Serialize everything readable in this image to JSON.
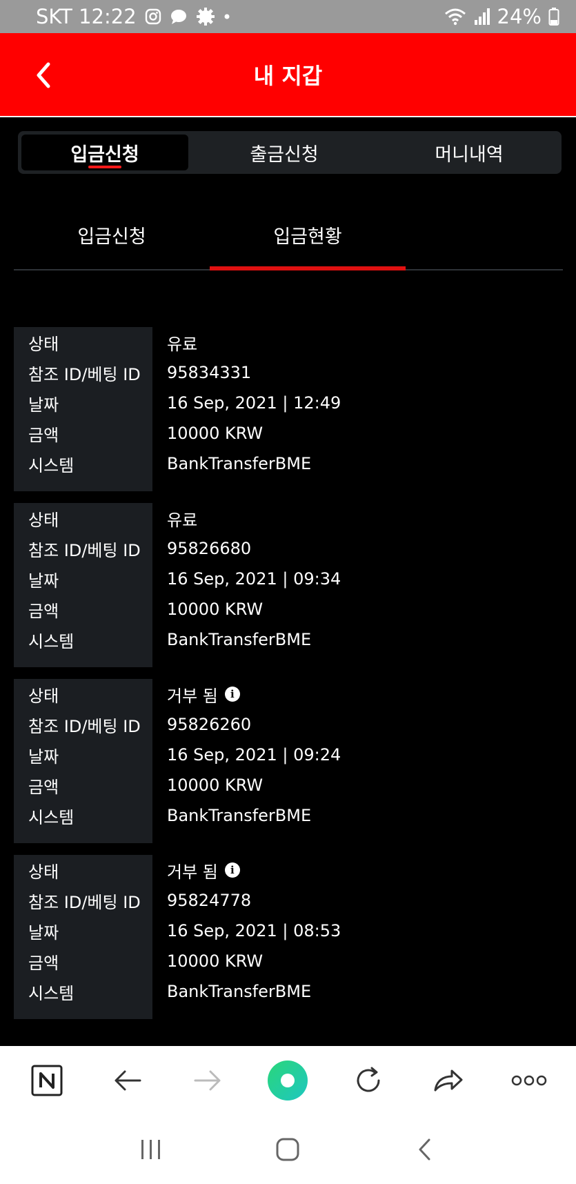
{
  "status_bar": {
    "carrier_time": "SKT 12:22",
    "battery": "24%"
  },
  "header": {
    "title": "내 지갑"
  },
  "segment_tabs": [
    {
      "label": "입금신청",
      "active": true
    },
    {
      "label": "출금신청",
      "active": false
    },
    {
      "label": "머니내역",
      "active": false
    }
  ],
  "sub_tabs": [
    {
      "label": "입금신청",
      "active": false
    },
    {
      "label": "입금현황",
      "active": true
    }
  ],
  "labels": {
    "status": "상태",
    "ref_id": "참조 ID/베팅 ID",
    "date": "날짜",
    "amount": "금액",
    "system": "시스템"
  },
  "records": [
    {
      "status": "유료",
      "status_info": false,
      "ref_id": "95834331",
      "date": "16 Sep, 2021 | 12:49",
      "amount": "10000 KRW",
      "system": "BankTransferBME"
    },
    {
      "status": "유료",
      "status_info": false,
      "ref_id": "95826680",
      "date": "16 Sep, 2021 | 09:34",
      "amount": "10000 KRW",
      "system": "BankTransferBME"
    },
    {
      "status": "거부 됨",
      "status_info": true,
      "ref_id": "95826260",
      "date": "16 Sep, 2021 | 09:24",
      "amount": "10000 KRW",
      "system": "BankTransferBME"
    },
    {
      "status": "거부 됨",
      "status_info": true,
      "ref_id": "95824778",
      "date": "16 Sep, 2021 | 08:53",
      "amount": "10000 KRW",
      "system": "BankTransferBME"
    }
  ],
  "icons": {
    "info": "i",
    "menu_dots": "ooo"
  },
  "colors": {
    "header_red": "#ff0000",
    "accent_red": "#e01010",
    "background": "#000000",
    "label_bg": "#1b1e22",
    "browser_home_green": "#22d38a"
  }
}
